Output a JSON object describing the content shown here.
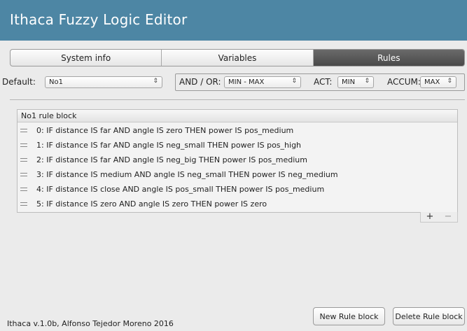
{
  "window": {
    "title": "Ithaca Fuzzy Logic Editor"
  },
  "tabs": [
    {
      "label": "System info",
      "active": false
    },
    {
      "label": "Variables",
      "active": false
    },
    {
      "label": "Rules",
      "active": true
    }
  ],
  "toolbar": {
    "default_label": "Default:",
    "default_value": "No1",
    "andor_label": "AND / OR:",
    "andor_value": "MIN - MAX",
    "act_label": "ACT:",
    "act_value": "MIN",
    "accum_label": "ACCUM:",
    "accum_value": "MAX"
  },
  "rule_block": {
    "header": "No1 rule block",
    "rules": [
      "0: IF distance IS far AND angle IS zero THEN power IS pos_medium",
      "1: IF distance IS far AND angle IS neg_small THEN power IS pos_high",
      "2: IF distance IS far AND angle IS neg_big THEN power IS pos_medium",
      "3: IF distance IS medium AND angle IS neg_small THEN power IS neg_medium",
      "4: IF distance IS close AND angle IS pos_small THEN power IS pos_medium",
      "5: IF distance IS zero AND angle IS zero THEN power IS zero"
    ],
    "add_symbol": "+",
    "remove_symbol": "−"
  },
  "footer": {
    "credits": "Ithaca v.1.0b, Alfonso Tejedor Moreno 2016",
    "new_block_label": "New Rule block",
    "delete_block_label": "Delete Rule block"
  },
  "colors": {
    "title_bar": "#4d86a4",
    "active_tab": "#555555",
    "background": "#ebebeb"
  },
  "icons": {
    "select_arrow": "updown-arrow-icon",
    "row_handle": "drag-handle-icon"
  }
}
